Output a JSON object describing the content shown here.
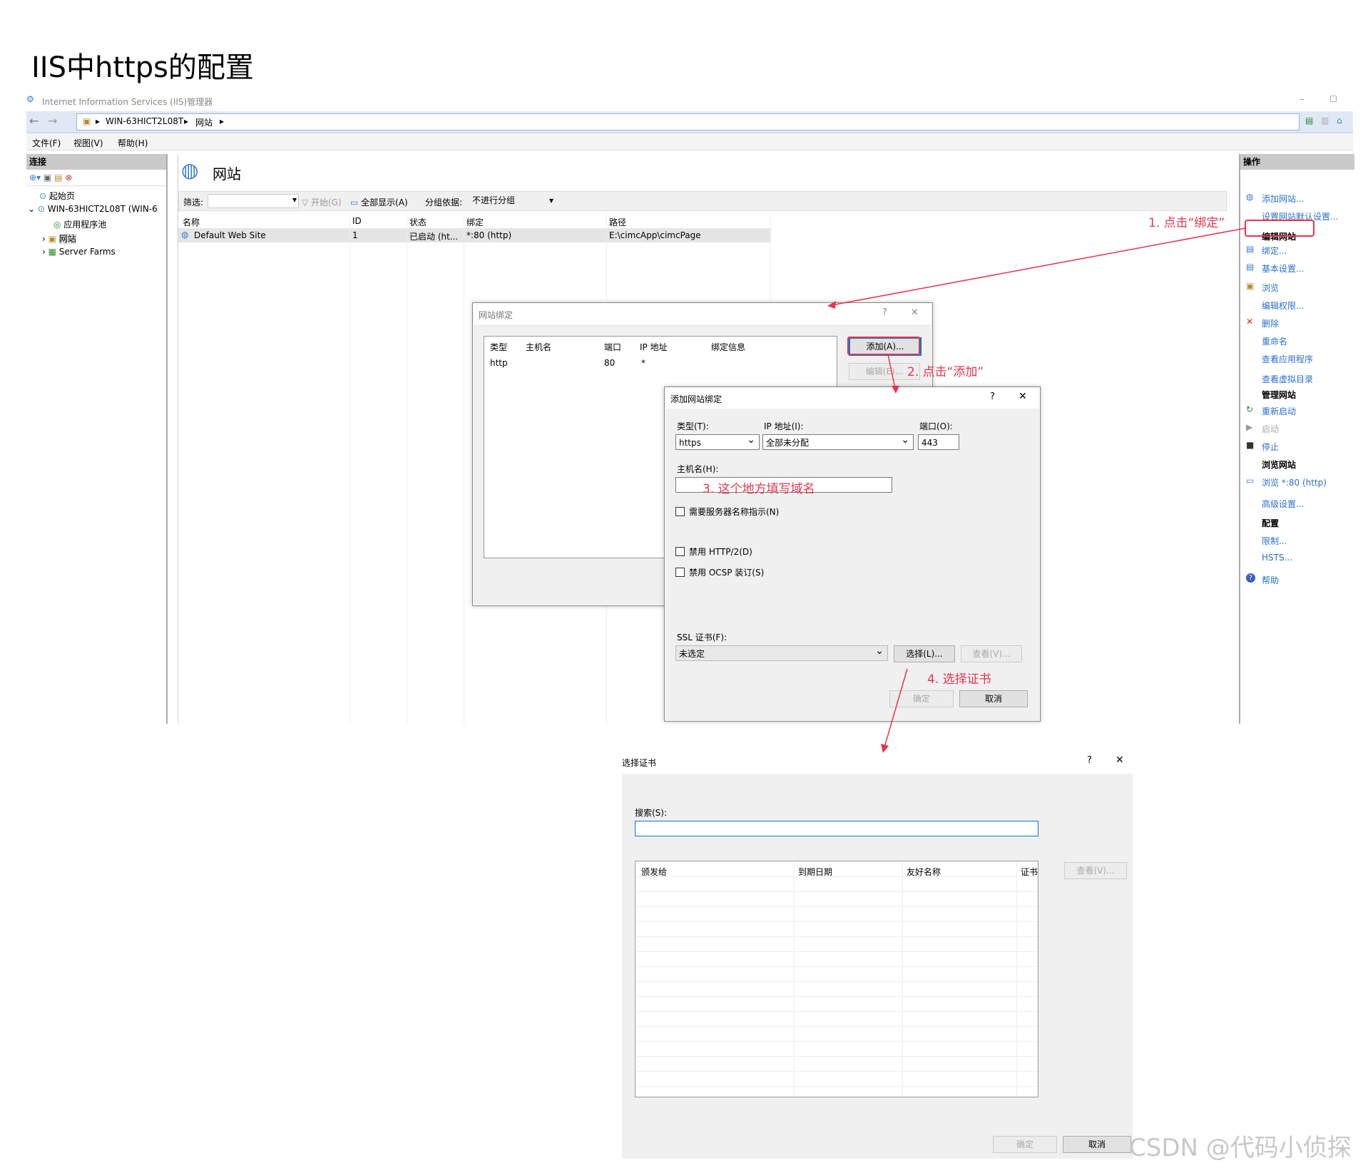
{
  "page_title": "IIS中https的配置",
  "window": {
    "title": "Internet Information Services (IIS)管理器",
    "minimize": "–",
    "maximize": "☐"
  },
  "breadcrumb": [
    "WIN-63HICT2L08T",
    "网站"
  ],
  "menu": [
    "文件(F)",
    "视图(V)",
    "帮助(H)"
  ],
  "connections": {
    "header": "连接",
    "tree": [
      "起始页",
      "WIN-63HICT2L08T (WIN-6",
      "应用程序池",
      "网站",
      "Server Farms"
    ]
  },
  "main": {
    "title": "网站",
    "toolbar": {
      "filter_label": "筛选:",
      "start": "开始(G)",
      "show_all": "全部显示(A)",
      "group_label": "分组依据:",
      "group_value": "不进行分组"
    },
    "columns": [
      "名称",
      "ID",
      "状态",
      "绑定",
      "路径"
    ],
    "rows": [
      {
        "name": "Default Web Site",
        "id": "1",
        "status": "已启动 (ht...",
        "binding": "*:80 (http)",
        "path": "E:\\cimcApp\\cimcPage"
      }
    ]
  },
  "actions": {
    "header": "操作",
    "items": [
      {
        "type": "link",
        "label": "添加网站..."
      },
      {
        "type": "link",
        "label": "设置网站默认设置..."
      },
      {
        "type": "header",
        "label": "编辑网站"
      },
      {
        "type": "link",
        "label": "绑定..."
      },
      {
        "type": "link",
        "label": "基本设置..."
      },
      {
        "type": "link",
        "label": "浏览"
      },
      {
        "type": "link",
        "label": "编辑权限..."
      },
      {
        "type": "link",
        "label": "删除"
      },
      {
        "type": "link",
        "label": "重命名"
      },
      {
        "type": "link",
        "label": "查看应用程序"
      },
      {
        "type": "link",
        "label": "查看虚拟目录"
      },
      {
        "type": "header",
        "label": "管理网站"
      },
      {
        "type": "link",
        "label": "重新启动"
      },
      {
        "type": "link",
        "label": "启动"
      },
      {
        "type": "link",
        "label": "停止"
      },
      {
        "type": "header",
        "label": "浏览网站"
      },
      {
        "type": "link",
        "label": "浏览 *:80 (http)"
      },
      {
        "type": "link",
        "label": "高级设置..."
      },
      {
        "type": "header",
        "label": "配置"
      },
      {
        "type": "link",
        "label": "限制..."
      },
      {
        "type": "link",
        "label": "HSTS..."
      },
      {
        "type": "link",
        "label": "帮助"
      }
    ]
  },
  "site_bindings": {
    "title": "网站绑定",
    "help": "?",
    "close": "✕",
    "columns": [
      "类型",
      "主机名",
      "端口",
      "IP 地址",
      "绑定信息"
    ],
    "row": {
      "type": "http",
      "host": "",
      "port": "80",
      "ip": "*",
      "info": ""
    },
    "add_btn": "添加(A)...",
    "edit_btn": "编辑(E)..."
  },
  "add_binding": {
    "title": "添加网站绑定",
    "help": "?",
    "close": "✕",
    "type_label": "类型(T):",
    "type_value": "https",
    "ip_label": "IP 地址(I):",
    "ip_value": "全部未分配",
    "port_label": "端口(O):",
    "port_value": "443",
    "host_label": "主机名(H):",
    "sni": "需要服务器名称指示(N)",
    "disable_http2": "禁用 HTTP/2(D)",
    "disable_ocsp": "禁用 OCSP 装订(S)",
    "ssl_label": "SSL 证书(F):",
    "ssl_value": "未选定",
    "select_btn": "选择(L)...",
    "view_btn": "查看(V)...",
    "ok_btn": "确定",
    "cancel_btn": "取消"
  },
  "select_cert": {
    "title": "选择证书",
    "help": "?",
    "close": "✕",
    "search_label": "搜索(S):",
    "columns": [
      "颁发给",
      "到期日期",
      "友好名称",
      "证书"
    ],
    "view_btn": "查看(V)...",
    "ok_btn": "确定",
    "cancel_btn": "取消"
  },
  "annotations": {
    "step1": "1. 点击“绑定”",
    "step2": "2. 点击“添加”",
    "step3": "3. 这个地方填写域名",
    "step4": "4. 选择证书",
    "color": "#e8344e"
  },
  "watermark": "CSDN @代码小侦探"
}
